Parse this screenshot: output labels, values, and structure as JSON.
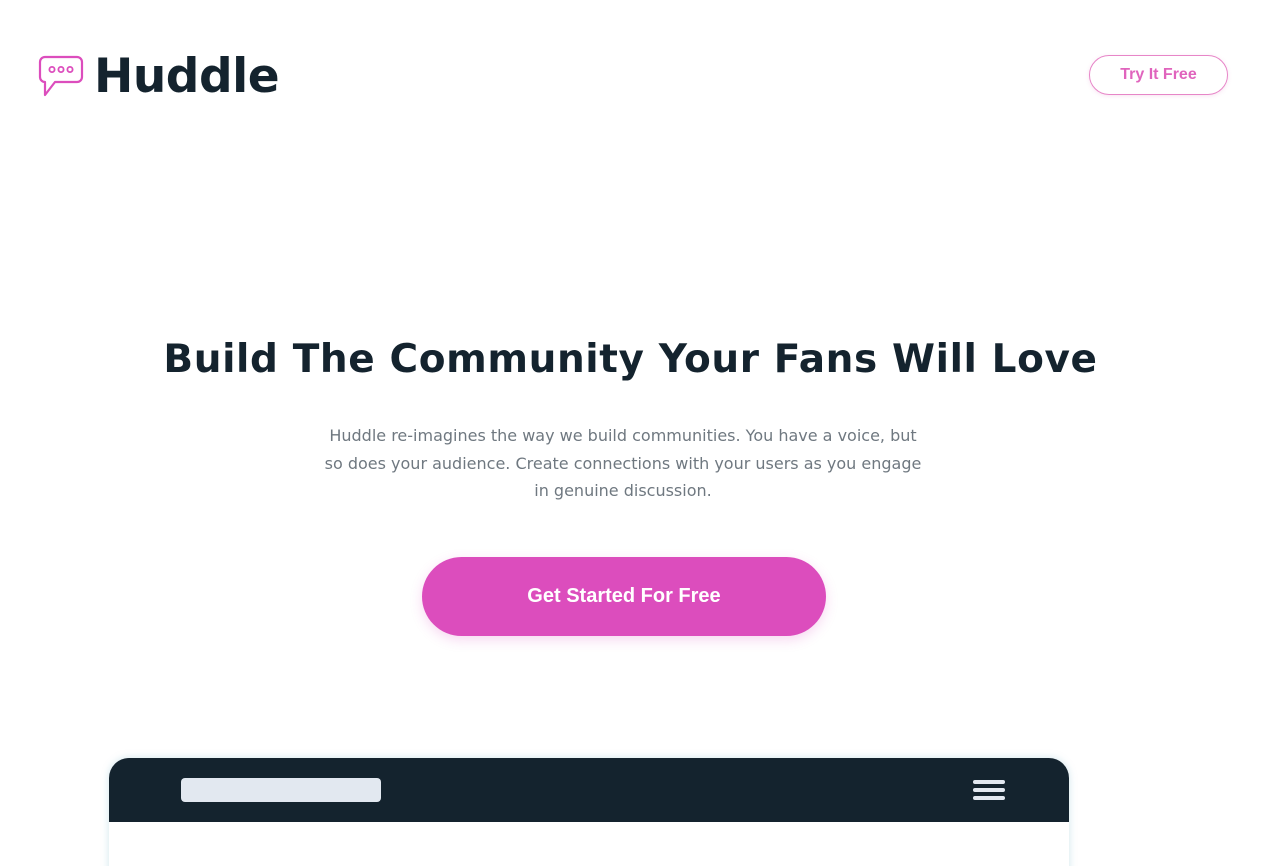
{
  "header": {
    "brand_name": "Huddle",
    "logo_icon": "chat-bubble-icon",
    "cta_label": "Try It Free"
  },
  "hero": {
    "title": "Build The Community Your Fans Will Love",
    "description": "Huddle re-imagines the way we build communities. You have a voice, but so does your audience. Create connections with your users as you engage in genuine discussion.",
    "cta_label": "Get Started For Free"
  },
  "mockup": {
    "menu_icon": "hamburger-menu-icon"
  },
  "colors": {
    "brand_pink": "#dc4dbd",
    "outline_pink": "#e786c8",
    "dark_navy": "#14232e",
    "body_gray": "#6f7880",
    "placeholder_gray": "#e2e8f0"
  }
}
